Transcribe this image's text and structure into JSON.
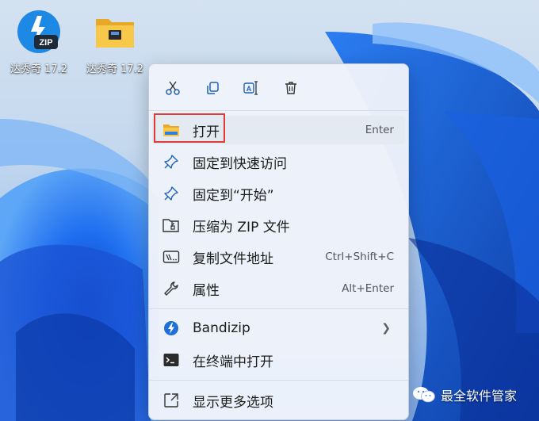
{
  "desktop": {
    "icons": [
      {
        "label": "达秀奇 17.2",
        "icon": "bandizip-zip-icon"
      },
      {
        "label": "达秀奇 17.2",
        "icon": "folder-icon"
      }
    ]
  },
  "context_menu": {
    "toolbar": [
      {
        "icon": "cut-icon"
      },
      {
        "icon": "copy-icon"
      },
      {
        "icon": "rename-icon"
      },
      {
        "icon": "delete-icon"
      }
    ],
    "items": [
      {
        "label": "打开",
        "shortcut": "Enter",
        "icon": "folder-icon"
      },
      {
        "label": "固定到快速访问",
        "shortcut": "",
        "icon": "pin-icon"
      },
      {
        "label": "固定到“开始”",
        "shortcut": "",
        "icon": "pin-icon"
      },
      {
        "label": "压缩为 ZIP 文件",
        "shortcut": "",
        "icon": "zip-folder-icon"
      },
      {
        "label": "复制文件地址",
        "shortcut": "Ctrl+Shift+C",
        "icon": "copy-path-icon"
      },
      {
        "label": "属性",
        "shortcut": "Alt+Enter",
        "icon": "wrench-icon"
      },
      {
        "label": "Bandizip",
        "shortcut": "",
        "icon": "bandizip-icon"
      },
      {
        "label": "在终端中打开",
        "shortcut": "",
        "icon": "terminal-icon"
      },
      {
        "label": "显示更多选项",
        "shortcut": "",
        "icon": "show-more-icon"
      }
    ]
  },
  "watermark": {
    "text": "最全软件管家"
  },
  "colors": {
    "accent": "#0067c0",
    "highlight_border": "#e53935",
    "folder": "#f7c84a"
  }
}
